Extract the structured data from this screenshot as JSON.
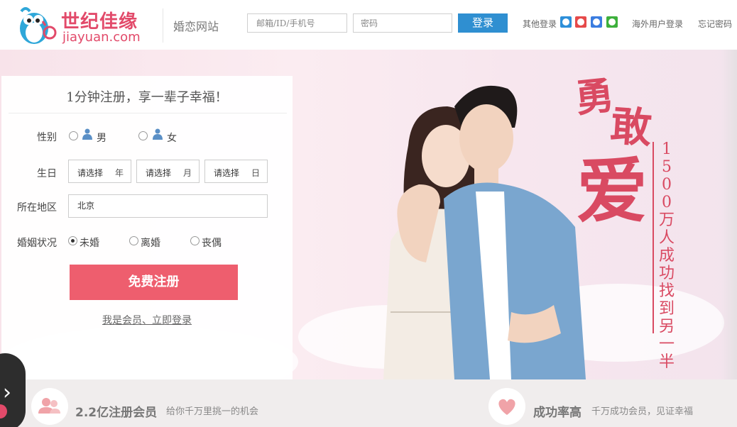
{
  "header": {
    "logo_cn": "世纪佳缘",
    "logo_en": "jiayuan.com",
    "site_name": "婚恋网站",
    "login": {
      "username_placeholder": "邮箱/ID/手机号",
      "password_placeholder": "密码",
      "button": "登录"
    },
    "other_login_label": "其他登录",
    "social_icons": [
      "qq-icon",
      "weibo-icon",
      "baidu-icon",
      "wechat-icon"
    ],
    "overseas_login": "海外用户登录",
    "forgot_password": "忘记密码"
  },
  "register": {
    "title": "1分钟注册，享一辈子幸福！",
    "gender_label": "性别",
    "gender_options": [
      "男",
      "女"
    ],
    "birthday_label": "生日",
    "birthday": {
      "year_placeholder": "请选择",
      "year_unit": "年",
      "month_placeholder": "请选择",
      "month_unit": "月",
      "day_placeholder": "请选择",
      "day_unit": "日"
    },
    "region_label": "所在地区",
    "region_value": "北京",
    "marital_label": "婚姻状况",
    "marital_options": [
      "未婚",
      "离婚",
      "丧偶"
    ],
    "marital_selected": "未婚",
    "submit": "免费注册",
    "member_link": "我是会员、立即登录"
  },
  "banner": {
    "slogan_1": "勇",
    "slogan_2": "敢",
    "slogan_3": "爱",
    "slogan_sub": "1500万人成功找到另一半"
  },
  "features": [
    {
      "title": "2.2亿注册会员",
      "desc": "给你千万里挑一的机会",
      "icon": "users-icon"
    },
    {
      "title": "成功率高",
      "desc": "千万成功会员，见证幸福",
      "icon": "heart-icon"
    }
  ],
  "colors": {
    "brand": "#e24a6a",
    "login_button": "#2f8fd1",
    "register_button": "#ee5e6e"
  }
}
